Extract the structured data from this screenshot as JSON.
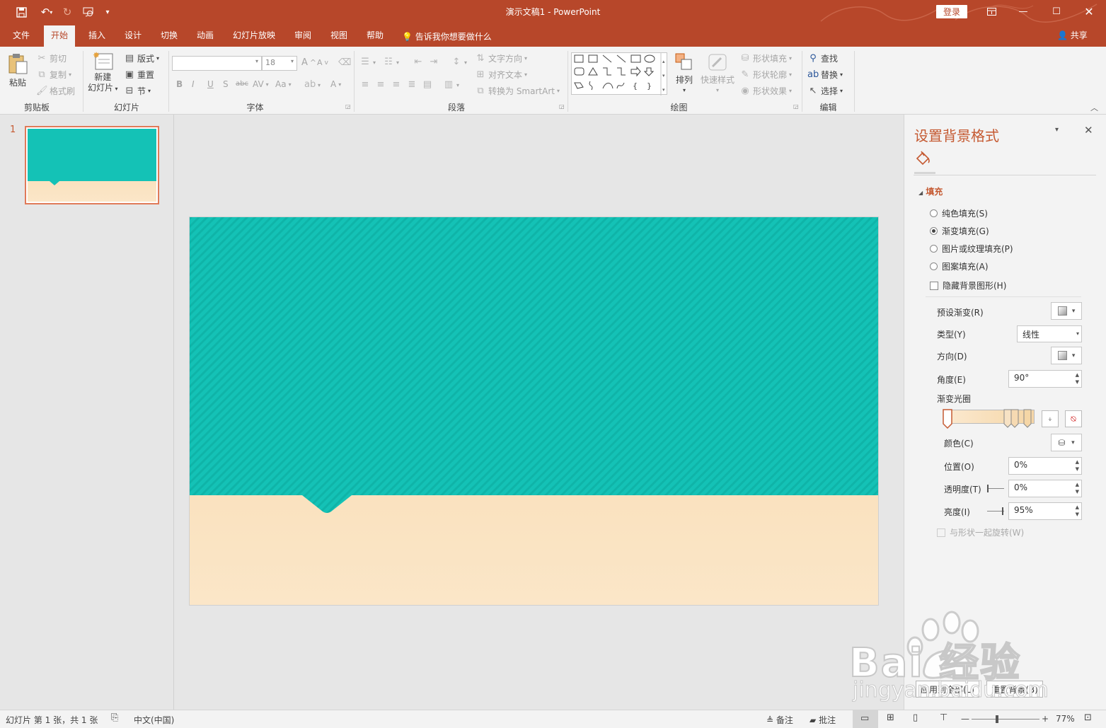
{
  "window": {
    "title": "演示文稿1  -  PowerPoint",
    "login": "登录"
  },
  "tabs": [
    {
      "label": "文件"
    },
    {
      "label": "开始"
    },
    {
      "label": "插入"
    },
    {
      "label": "设计"
    },
    {
      "label": "切换"
    },
    {
      "label": "动画"
    },
    {
      "label": "幻灯片放映"
    },
    {
      "label": "审阅"
    },
    {
      "label": "视图"
    },
    {
      "label": "帮助"
    }
  ],
  "tell_me": "告诉我你想要做什么",
  "share": "共享",
  "ribbon": {
    "clipboard": {
      "paste": "粘贴",
      "cut": "剪切",
      "copy": "复制",
      "format_painter": "格式刷",
      "label": "剪贴板"
    },
    "slides": {
      "new_slide_1": "新建",
      "new_slide_2": "幻灯片",
      "layout": "版式",
      "reset": "重置",
      "section": "节",
      "label": "幻灯片"
    },
    "font": {
      "font_size": "18",
      "label": "字体",
      "bold": "B",
      "italic": "I",
      "underline": "U",
      "shadow": "S",
      "strike": "abc",
      "spacing": "AV",
      "case": "Aa",
      "grow": "A",
      "shrink": "A",
      "color": "A"
    },
    "paragraph": {
      "text_direction": "文字方向",
      "align_text": "对齐文本",
      "smartart": "转换为 SmartArt",
      "label": "段落"
    },
    "drawing": {
      "arrange": "排列",
      "quick_styles": "快速样式",
      "shape_fill": "形状填充",
      "shape_outline": "形状轮廓",
      "shape_effects": "形状效果",
      "label": "绘图"
    },
    "editing": {
      "find": "查找",
      "replace": "替换",
      "select": "选择",
      "label": "编辑"
    }
  },
  "thumbnail": {
    "number": "1"
  },
  "slide": {
    "top_color": "#14c2b6",
    "bottom_color_top": "#f6d8a8",
    "bottom_color_bottom": "#fbe6c8"
  },
  "format_pane": {
    "title": "设置背景格式",
    "section": "填充",
    "options": [
      {
        "label": "纯色填充(S)",
        "selected": false
      },
      {
        "label": "渐变填充(G)",
        "selected": true
      },
      {
        "label": "图片或纹理填充(P)",
        "selected": false
      },
      {
        "label": "图案填充(A)",
        "selected": false
      }
    ],
    "hide_bg": "隐藏背景图形(H)",
    "preset_label": "预设渐变(R)",
    "type_label": "类型(Y)",
    "type_value": "线性",
    "direction_label": "方向(D)",
    "angle_label": "角度(E)",
    "angle_value": "90°",
    "stops_label": "渐变光圈",
    "color_label": "颜色(C)",
    "position_label": "位置(O)",
    "position_value": "0%",
    "transparency_label": "透明度(T)",
    "transparency_value": "0%",
    "brightness_label": "亮度(I)",
    "brightness_value": "95%",
    "rotate_with_shape": "与形状一起旋转(W)",
    "apply_all": "应用到全部(L)",
    "reset_bg": "重置背景(B)"
  },
  "status": {
    "slide_info": "幻灯片 第 1 张，共 1 张",
    "language": "中文(中国)",
    "notes": "备注",
    "comments": "批注",
    "zoom": "77%"
  },
  "watermark": {
    "brand": "Bai  经验",
    "url": "jingyan.baidu.com"
  }
}
